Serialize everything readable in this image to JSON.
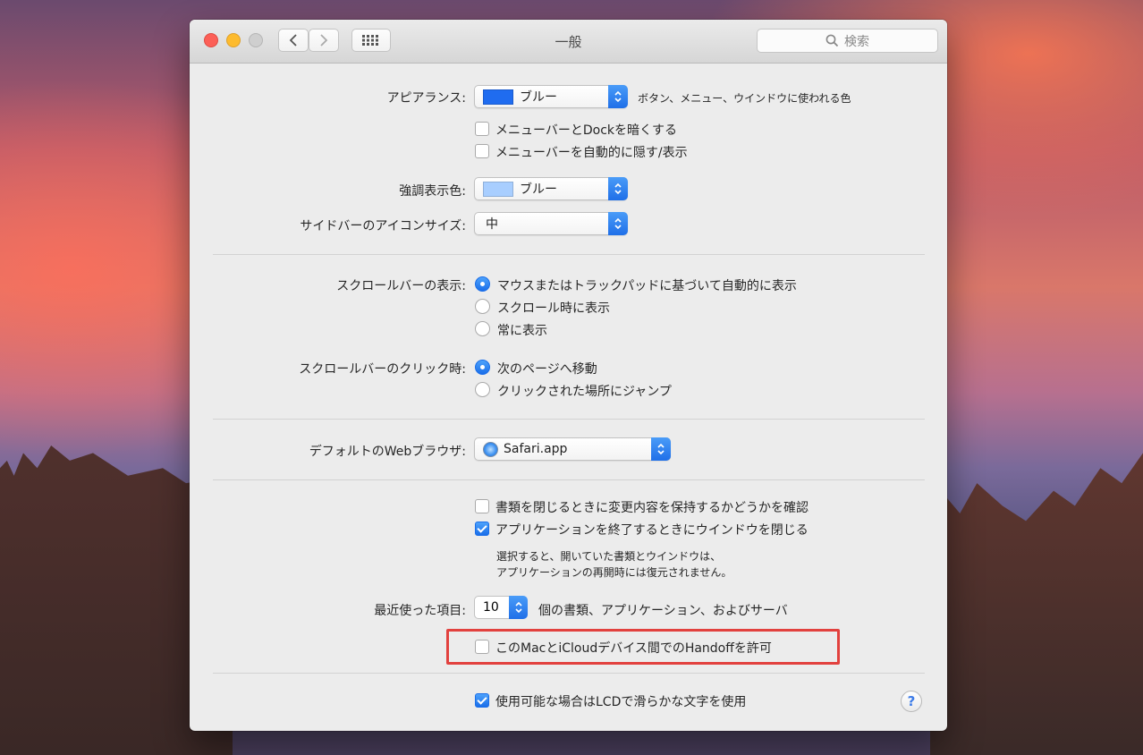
{
  "window": {
    "title": "一般",
    "search_placeholder": "検索"
  },
  "appearance": {
    "label": "アピアランス:",
    "value": "ブルー",
    "swatch_color": "#1f6cf0",
    "description": "ボタン、メニュー、ウインドウに使われる色",
    "dark_menu_label": "メニューバーとDockを暗くする",
    "dark_menu_checked": false,
    "autohide_menu_label": "メニューバーを自動的に隠す/表示",
    "autohide_menu_checked": false
  },
  "highlight": {
    "label": "強調表示色:",
    "value": "ブルー",
    "swatch_color": "#a8ceff"
  },
  "sidebar_icon": {
    "label": "サイドバーのアイコンサイズ:",
    "value": "中"
  },
  "scrollbars": {
    "label": "スクロールバーの表示:",
    "options": [
      {
        "label": "マウスまたはトラックパッドに基づいて自動的に表示",
        "selected": true
      },
      {
        "label": "スクロール時に表示",
        "selected": false
      },
      {
        "label": "常に表示",
        "selected": false
      }
    ]
  },
  "scroll_click": {
    "label": "スクロールバーのクリック時:",
    "options": [
      {
        "label": "次のページへ移動",
        "selected": true
      },
      {
        "label": "クリックされた場所にジャンプ",
        "selected": false
      }
    ]
  },
  "browser": {
    "label": "デフォルトのWebブラウザ:",
    "value": "Safari.app"
  },
  "documents": {
    "ask_keep_label": "書類を閉じるときに変更内容を保持するかどうかを確認",
    "ask_keep_checked": false,
    "close_windows_label": "アプリケーションを終了するときにウインドウを閉じる",
    "close_windows_checked": true,
    "note_line1": "選択すると、開いていた書類とウインドウは、",
    "note_line2": "アプリケーションの再開時には復元されません。"
  },
  "recent": {
    "label": "最近使った項目:",
    "value": "10",
    "suffix": "個の書類、アプリケーション、およびサーバ"
  },
  "handoff": {
    "label": "このMacとiCloudデバイス間でのHandoffを許可",
    "checked": false,
    "highlight_color": "#e2413e"
  },
  "lcd": {
    "label": "使用可能な場合はLCDで滑らかな文字を使用",
    "checked": true
  },
  "help": {
    "label": "?"
  }
}
